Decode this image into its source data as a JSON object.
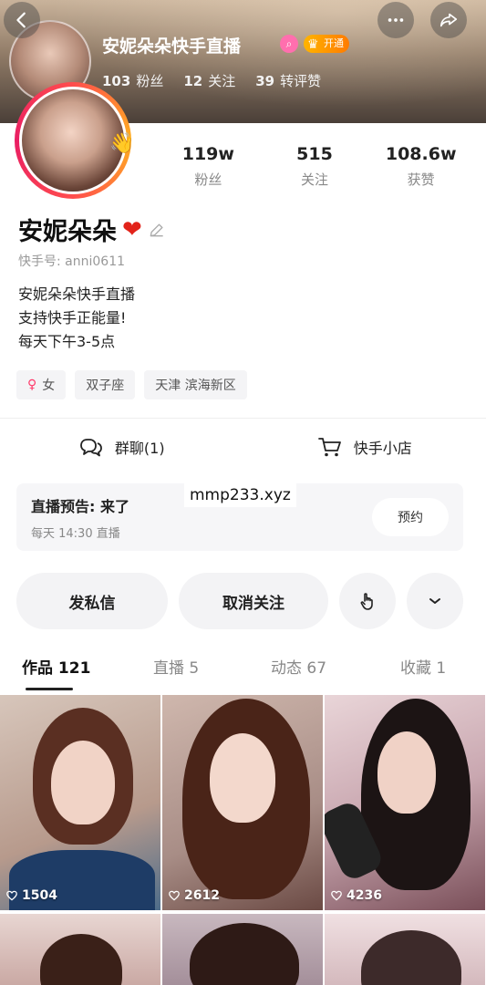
{
  "header": {
    "title": "安妮朵朵快手直播",
    "live_badge": "开通",
    "stats": [
      {
        "num": "103",
        "label": "粉丝"
      },
      {
        "num": "12",
        "label": "关注"
      },
      {
        "num": "39",
        "label": "转评赞"
      }
    ]
  },
  "profile": {
    "stats": [
      {
        "value": "119w",
        "label": "粉丝"
      },
      {
        "value": "515",
        "label": "关注"
      },
      {
        "value": "108.6w",
        "label": "获赞"
      }
    ],
    "name": "安妮朵朵",
    "heart": "❤",
    "uid": "快手号: anni0611",
    "bio": [
      "安妮朵朵快手直播",
      "支持快手正能量!",
      "每天下午3-5点"
    ],
    "tags": [
      {
        "label": "女",
        "icon": "female-icon"
      },
      {
        "label": "双子座"
      },
      {
        "label": "天津 滨海新区"
      }
    ]
  },
  "quick_links": {
    "group_chat": "群聊(1)",
    "shop": "快手小店"
  },
  "live_preview": {
    "title": "直播预告: 来了",
    "time": "每天 14:30 直播",
    "button": "预约"
  },
  "watermark": "mmp233.xyz",
  "actions": {
    "message": "发私信",
    "unfollow": "取消关注"
  },
  "tabs": [
    {
      "label": "作品 121",
      "active": true
    },
    {
      "label": "直播 5"
    },
    {
      "label": "动态 67"
    },
    {
      "label": "收藏 1"
    }
  ],
  "videos": [
    {
      "likes": "1504"
    },
    {
      "likes": "2612"
    },
    {
      "likes": "4236"
    }
  ],
  "colors": {
    "accent": "#ff4d4d",
    "heart": "#e2231a",
    "badge_orange": "#ff9a00"
  }
}
